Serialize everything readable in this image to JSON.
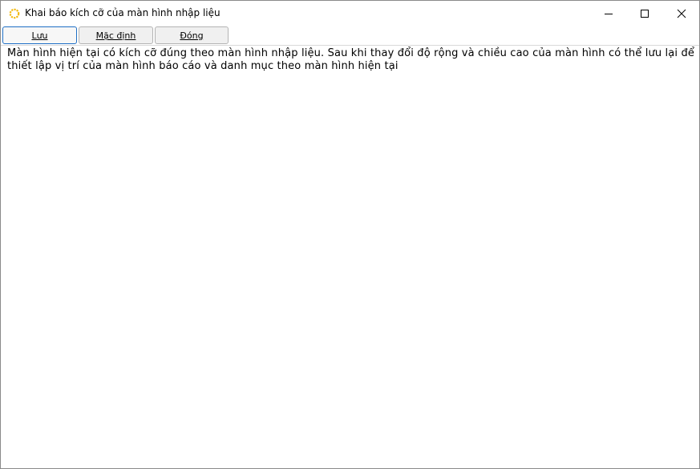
{
  "window": {
    "title": "Khai báo kích cỡ của màn hình nhập liệu",
    "icon": "sun-icon"
  },
  "toolbar": {
    "save_label": "Lưu",
    "default_label": "Mặc định",
    "close_label": "Đóng"
  },
  "content": {
    "message": "Màn hình hiện tại có kích cỡ đúng theo màn hình nhập liệu. Sau khi thay đổi độ rộng và chiều cao của màn hình có thể lưu lại để thiết lập vị trí của màn hình báo cáo và danh mục theo màn hình hiện tại"
  },
  "colors": {
    "icon_accent": "#f2b90c",
    "focus_border": "#1f6fc5"
  }
}
